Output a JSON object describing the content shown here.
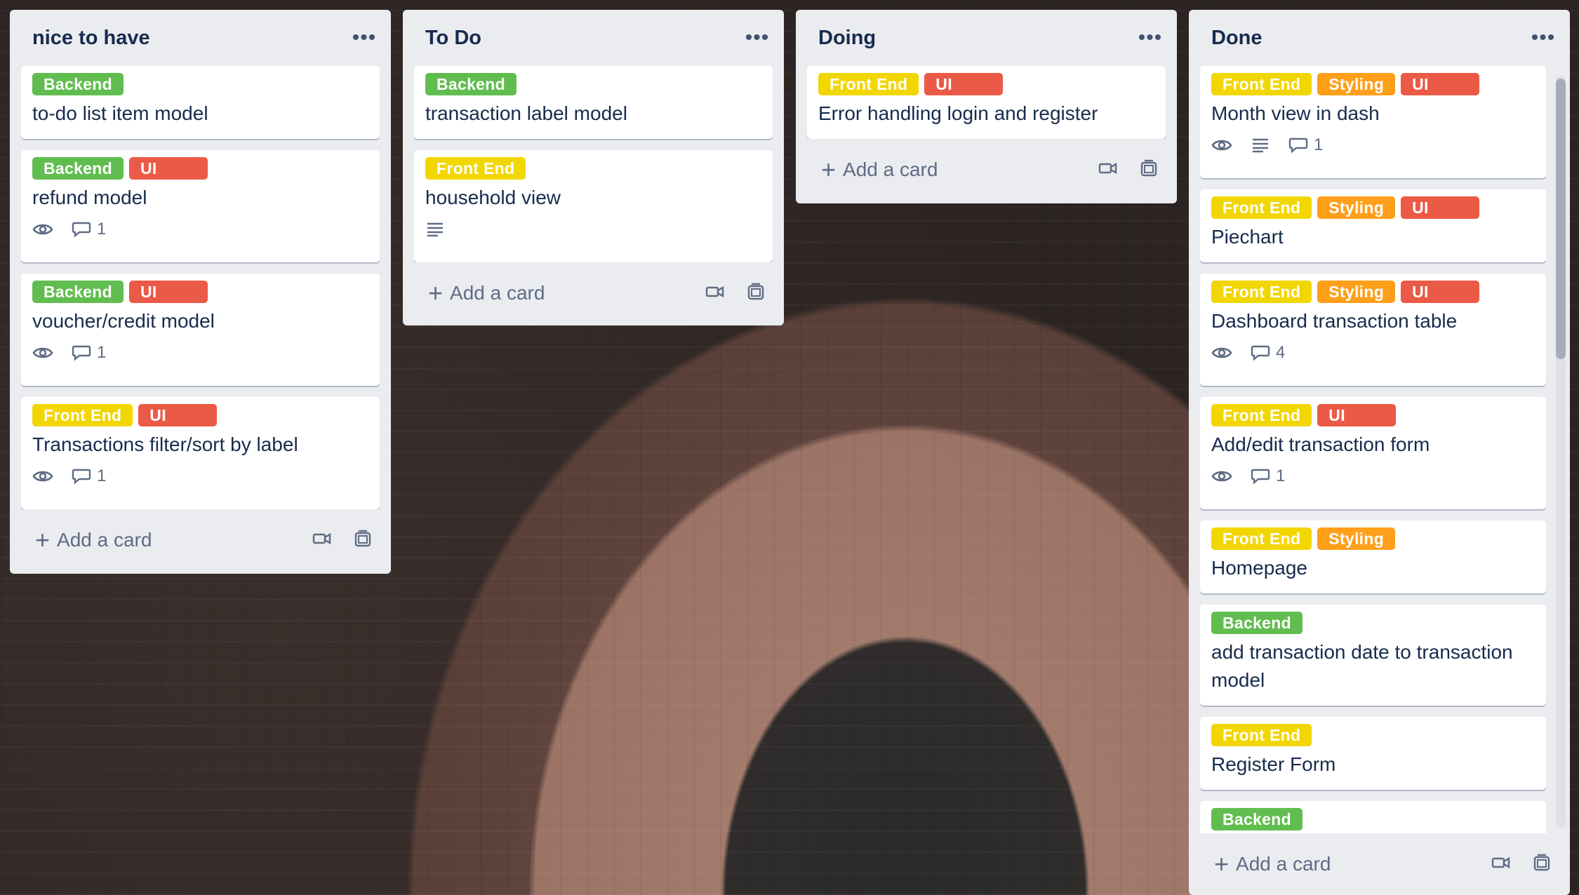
{
  "lists": [
    {
      "title": "nice to have",
      "add_card": "Add a card",
      "cards": [
        {
          "labels": [
            {
              "text": "Backend",
              "color": "green"
            }
          ],
          "title": "to-do list item model"
        },
        {
          "labels": [
            {
              "text": "Backend",
              "color": "green"
            },
            {
              "text": "UI",
              "color": "red"
            }
          ],
          "title": "refund model",
          "comments": "1"
        },
        {
          "labels": [
            {
              "text": "Backend",
              "color": "green"
            },
            {
              "text": "UI",
              "color": "red"
            }
          ],
          "title": "voucher/credit model",
          "comments": "1"
        },
        {
          "labels": [
            {
              "text": "Front End",
              "color": "yellow"
            },
            {
              "text": "UI",
              "color": "red"
            }
          ],
          "title": "Transactions filter/sort by label",
          "comments": "1"
        }
      ]
    },
    {
      "title": "To Do",
      "add_card": "Add a card",
      "cards": [
        {
          "labels": [
            {
              "text": "Backend",
              "color": "green"
            }
          ],
          "title": "transaction label model"
        },
        {
          "labels": [
            {
              "text": "Front End",
              "color": "yellow"
            }
          ],
          "title": "household view"
        }
      ]
    },
    {
      "title": "Doing",
      "add_card": "Add a card",
      "cards": [
        {
          "labels": [
            {
              "text": "Front End",
              "color": "yellow"
            },
            {
              "text": "UI",
              "color": "red"
            }
          ],
          "title": "Error handling login and register"
        }
      ]
    },
    {
      "title": "Done",
      "add_card": "Add a card",
      "cards": [
        {
          "labels": [
            {
              "text": "Front End",
              "color": "yellow"
            },
            {
              "text": "Styling",
              "color": "orange"
            },
            {
              "text": "UI",
              "color": "red"
            }
          ],
          "title": "Month view in dash",
          "comments": "1"
        },
        {
          "labels": [
            {
              "text": "Front End",
              "color": "yellow"
            },
            {
              "text": "Styling",
              "color": "orange"
            },
            {
              "text": "UI",
              "color": "red"
            }
          ],
          "title": "Piechart"
        },
        {
          "labels": [
            {
              "text": "Front End",
              "color": "yellow"
            },
            {
              "text": "Styling",
              "color": "orange"
            },
            {
              "text": "UI",
              "color": "red"
            }
          ],
          "title": "Dashboard transaction table",
          "comments": "4"
        },
        {
          "labels": [
            {
              "text": "Front End",
              "color": "yellow"
            },
            {
              "text": "UI",
              "color": "red"
            }
          ],
          "title": "Add/edit transaction form",
          "comments": "1"
        },
        {
          "labels": [
            {
              "text": "Front End",
              "color": "yellow"
            },
            {
              "text": "Styling",
              "color": "orange"
            }
          ],
          "title": "Homepage"
        },
        {
          "labels": [
            {
              "text": "Backend",
              "color": "green"
            }
          ],
          "title": "add transaction date to transaction model"
        },
        {
          "labels": [
            {
              "text": "Front End",
              "color": "yellow"
            }
          ],
          "title": "Register Form"
        },
        {
          "labels": [
            {
              "text": "Backend",
              "color": "green"
            }
          ]
        }
      ]
    }
  ],
  "colors": {
    "green": "#61bd4f",
    "yellow": "#f2d600",
    "orange": "#ff9f1a",
    "red": "#eb5a46",
    "list_bg": "#ebecf0"
  },
  "icons": {
    "list_menu": "more-icon",
    "watch": "eye-icon",
    "description": "description-icon",
    "comment": "comment-icon",
    "template": "template-icon",
    "camera": "video-icon"
  }
}
